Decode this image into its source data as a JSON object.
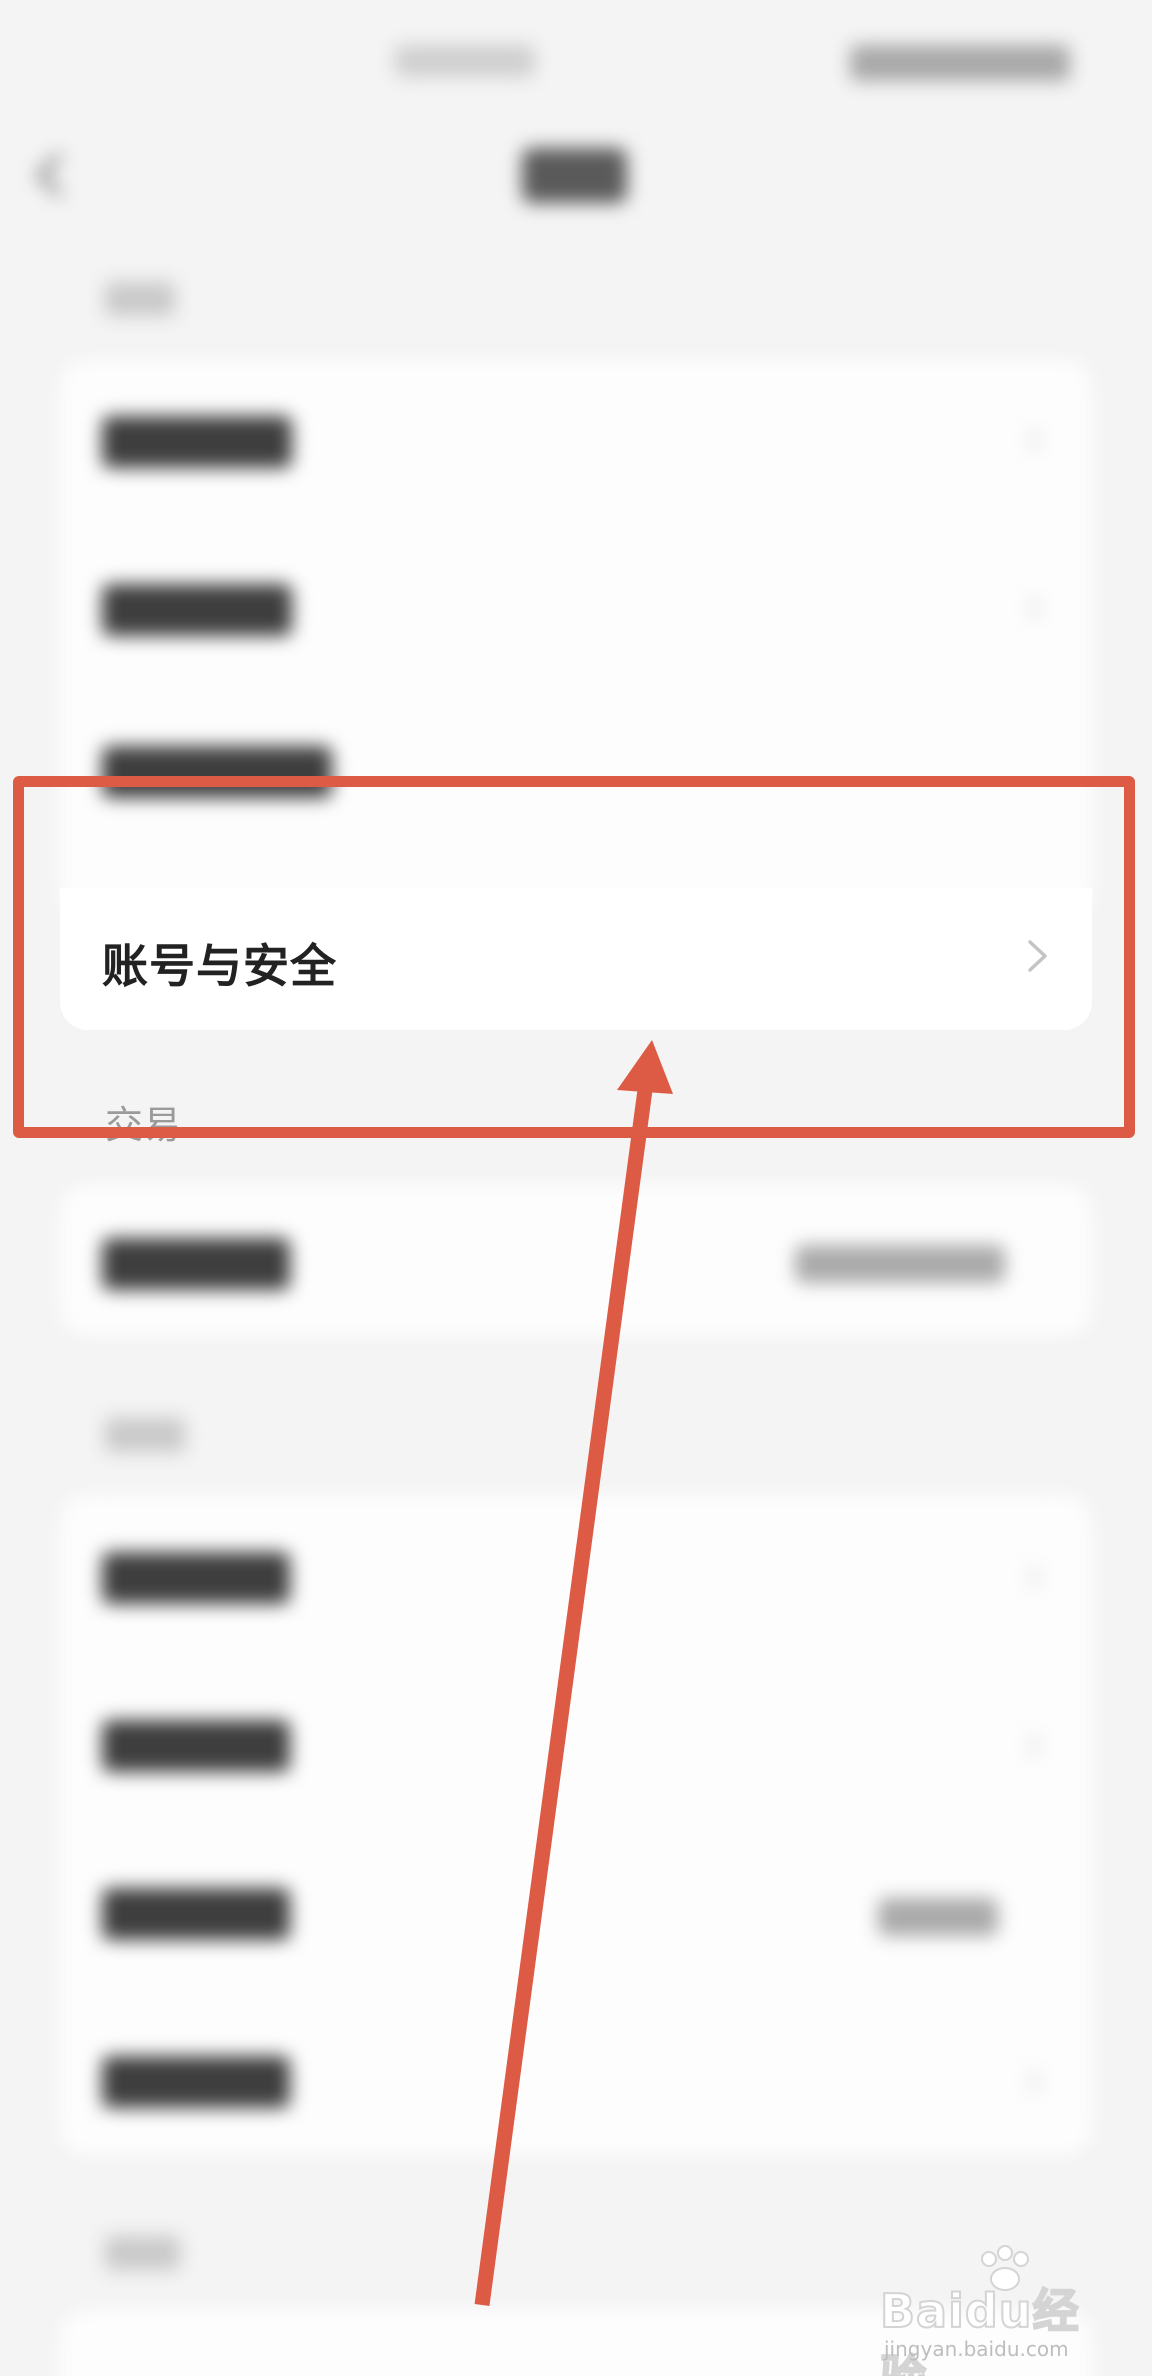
{
  "settings": {
    "account_security_label": "账号与安全",
    "trade_section_label": "交易"
  },
  "watermark": {
    "brand": "Bai",
    "brand_suffix": "du",
    "product": "经验",
    "url": "jingyan.baidu.com"
  },
  "colors": {
    "annotation_red": "#dd5a45",
    "background": "#f4f4f4",
    "card": "#ffffff"
  }
}
